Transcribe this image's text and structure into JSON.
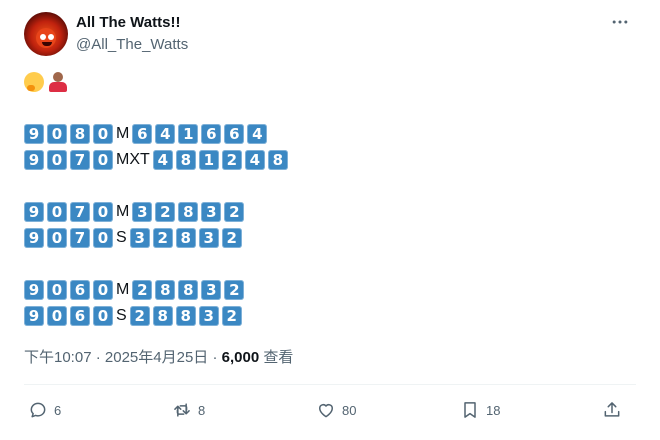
{
  "author": {
    "display_name": "All The Watts!!",
    "handle": "@All_The_Watts"
  },
  "tweet": {
    "emojis": [
      "thinking-face-emoji",
      "person-shrugging-emoji"
    ],
    "lines": [
      {
        "model": [
          "9",
          "0",
          "8",
          "0"
        ],
        "suffix": "M",
        "specs": [
          "6",
          "4",
          "1",
          "6",
          "6",
          "4"
        ]
      },
      {
        "model": [
          "9",
          "0",
          "7",
          "0"
        ],
        "suffix": "MXT",
        "specs": [
          "4",
          "8",
          "1",
          "2",
          "4",
          "8"
        ]
      },
      {
        "model": [
          "9",
          "0",
          "7",
          "0"
        ],
        "suffix": "M",
        "specs": [
          "3",
          "2",
          "8",
          "3",
          "2"
        ]
      },
      {
        "model": [
          "9",
          "0",
          "7",
          "0"
        ],
        "suffix": "S",
        "specs": [
          "3",
          "2",
          "8",
          "3",
          "2"
        ]
      },
      {
        "model": [
          "9",
          "0",
          "6",
          "0"
        ],
        "suffix": "M",
        "specs": [
          "2",
          "8",
          "8",
          "3",
          "2"
        ]
      },
      {
        "model": [
          "9",
          "0",
          "6",
          "0"
        ],
        "suffix": "S",
        "specs": [
          "2",
          "8",
          "8",
          "3",
          "2"
        ]
      }
    ]
  },
  "meta": {
    "time": "下午10:07",
    "date": "2025年4月25日",
    "views_count": "6,000",
    "views_label": "查看",
    "separator": "·"
  },
  "actions": {
    "reply_count": "6",
    "retweet_count": "8",
    "like_count": "80",
    "bookmark_count": "18"
  },
  "colors": {
    "keycap": "#3b88c3",
    "text": "#0f1419",
    "secondary": "#536471"
  }
}
